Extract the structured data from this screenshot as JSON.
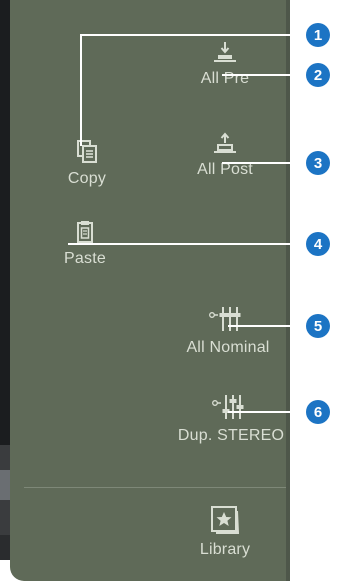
{
  "buttons": {
    "copy": "Copy",
    "all_pre": "All Pre",
    "all_post": "All Post",
    "paste": "Paste",
    "all_nominal": "All Nominal",
    "dup_stereo": "Dup. STEREO",
    "library": "Library"
  },
  "icons": {
    "copy": "copy-icon",
    "all_pre": "all-pre-icon",
    "all_post": "all-post-icon",
    "paste": "paste-icon",
    "all_nominal": "fader-nominal-icon",
    "dup_stereo": "fader-dup-stereo-icon",
    "library": "library-star-icon"
  },
  "callouts": [
    "1",
    "2",
    "3",
    "4",
    "5",
    "6"
  ],
  "colors": {
    "panel": "#5f6a58",
    "text": "#d9ded3",
    "callout_badge": "#1c74c4"
  }
}
